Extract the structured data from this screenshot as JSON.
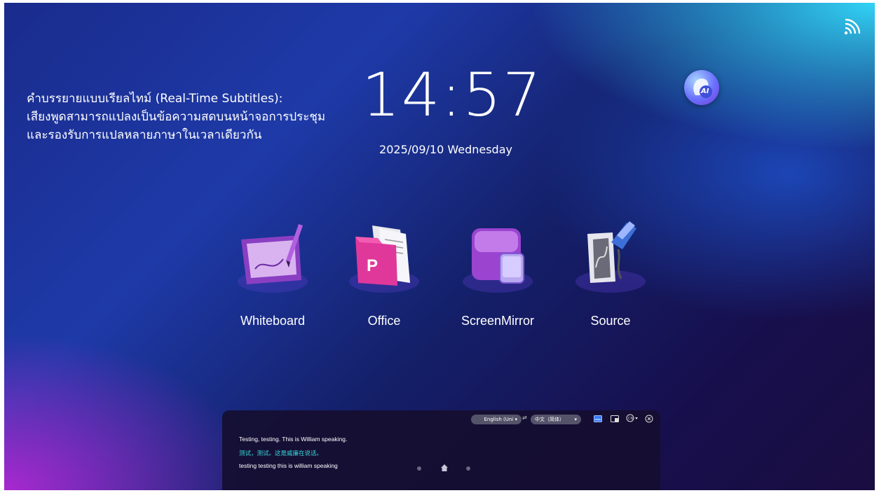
{
  "caption": {
    "line1": "คำบรรยายแบบเรียลไทม์ (Real-Time Subtitles):",
    "line2": "เสียงพูดสามารถแปลงเป็นข้อความสดบนหน้าจอการประชุม",
    "line3": "และรองรับการแปลหลายภาษาในเวลาเดียวกัน"
  },
  "clock": {
    "time": "14:57",
    "date": "2025/09/10 Wednesday"
  },
  "top_icons": [
    "cast-icon",
    "ai-assistant-icon"
  ],
  "ai_badge": "AI",
  "apps": [
    {
      "label": "Whiteboard",
      "icon": "whiteboard-icon"
    },
    {
      "label": "Office",
      "icon": "office-icon"
    },
    {
      "label": "ScreenMirror",
      "icon": "screen-mirror-icon"
    },
    {
      "label": "Source",
      "icon": "source-icon"
    }
  ],
  "subtitle_panel": {
    "source_lang": "English (Uni",
    "target_lang": "中文（简体）",
    "lines": [
      "Testing, testing. This is William speaking.",
      "测试，测试。这是威廉在说话。",
      "testing testing this is william speaking"
    ],
    "translation_color": "#35d6d6",
    "controls": [
      "swap-icon",
      "subtitle-icon",
      "window-icon",
      "display-mode-icon",
      "close-icon"
    ]
  },
  "nav_icons": [
    "back-dot",
    "home-icon",
    "recent-dot"
  ],
  "colors": {
    "accent_cyan": "#35d6d6",
    "app_pink": "#e0389a",
    "app_purple": "#a84fd6"
  }
}
